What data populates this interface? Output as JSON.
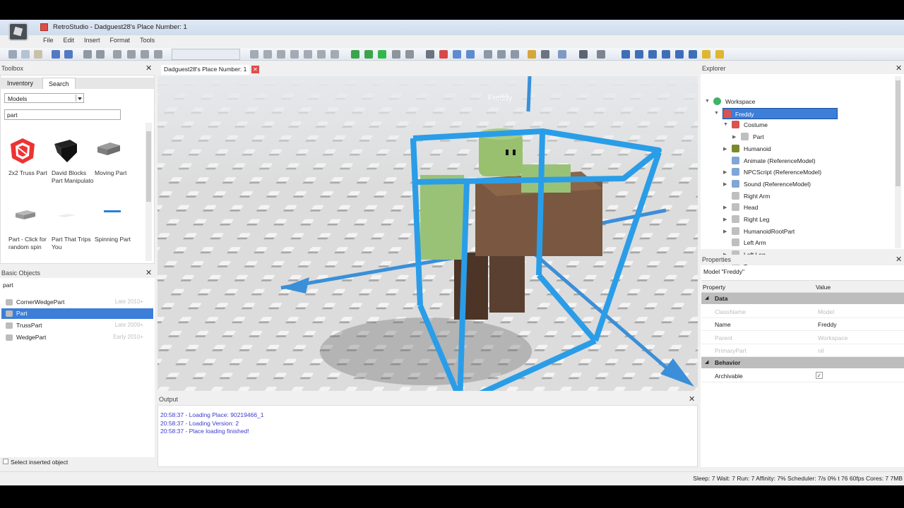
{
  "window": {
    "title": "RetroStudio - Dadguest28's Place Number: 1"
  },
  "menu": [
    "File",
    "Edit",
    "Insert",
    "Format",
    "Tools"
  ],
  "toolbox": {
    "title": "Toolbox",
    "tabs": [
      "Inventory",
      "Search"
    ],
    "category": "Models",
    "search_value": "part",
    "models": [
      {
        "label": "2x2 Truss Part",
        "icon": "truss-icon"
      },
      {
        "label": "David Blocks Part Manipulato",
        "icon": "manipulator-icon"
      },
      {
        "label": "Moving Part",
        "icon": "brick-icon"
      },
      {
        "label": "Part - Click for random spin",
        "icon": "brick-icon"
      },
      {
        "label": "Part That Trips You",
        "icon": "flat-part-icon"
      },
      {
        "label": "Spinning Part",
        "icon": "bar-icon"
      }
    ]
  },
  "basic_objects": {
    "title": "Basic Objects",
    "search_value": "part",
    "items": [
      {
        "label": "CornerWedgePart",
        "date": "Late 2010+"
      },
      {
        "label": "Part",
        "date": ""
      },
      {
        "label": "TrussPart",
        "date": "Late 2009+"
      },
      {
        "label": "WedgePart",
        "date": "Early 2010+"
      }
    ],
    "checkbox_label": "Select inserted object"
  },
  "document_tab": "Dadguest28's Place Number: 1",
  "viewport": {
    "name_tag": "Freddy"
  },
  "output": {
    "title": "Output",
    "lines": [
      "20:58:37 - Loading Place: 90219466_1",
      "20:58:37 - Loading Version: 2",
      "20:58:37 - Place loading finished!"
    ]
  },
  "explorer": {
    "title": "Explorer",
    "items": [
      {
        "label": "Workspace",
        "depth": 0,
        "icon": "globe-icon"
      },
      {
        "label": "Freddy",
        "depth": 1,
        "icon": "model-icon",
        "selected": true
      },
      {
        "label": "Costume",
        "depth": 2,
        "icon": "model-icon"
      },
      {
        "label": "Part",
        "depth": 3,
        "icon": "part-icon"
      },
      {
        "label": "Humanoid",
        "depth": 2,
        "icon": "humanoid-icon"
      },
      {
        "label": "Animate (ReferenceModel)",
        "depth": 2,
        "icon": "script-icon"
      },
      {
        "label": "NPCScript (ReferenceModel)",
        "depth": 2,
        "icon": "script-icon"
      },
      {
        "label": "Sound (ReferenceModel)",
        "depth": 2,
        "icon": "script-icon"
      },
      {
        "label": "Right Arm",
        "depth": 2,
        "icon": "part-icon"
      },
      {
        "label": "Head",
        "depth": 2,
        "icon": "part-icon"
      },
      {
        "label": "Right Leg",
        "depth": 2,
        "icon": "part-icon"
      },
      {
        "label": "HumanoidRootPart",
        "depth": 2,
        "icon": "part-icon"
      },
      {
        "label": "Left Arm",
        "depth": 2,
        "icon": "part-icon"
      },
      {
        "label": "Left Leg",
        "depth": 2,
        "icon": "part-icon"
      },
      {
        "label": "Torso",
        "depth": 2,
        "icon": "part-icon"
      }
    ]
  },
  "properties": {
    "title": "Properties",
    "subtitle": "Model \"Freddy\"",
    "col_property": "Property",
    "col_value": "Value",
    "categories": [
      {
        "name": "Data",
        "rows": [
          {
            "k": "ClassName",
            "v": "Model",
            "dim": true
          },
          {
            "k": "Name",
            "v": "Freddy",
            "dim": false
          },
          {
            "k": "Parent",
            "v": "Workspace",
            "dim": true
          },
          {
            "k": "PrimaryPart",
            "v": "nil",
            "dim": true
          }
        ]
      },
      {
        "name": "Behavior",
        "rows": [
          {
            "k": "Archivable",
            "v": "✓",
            "dim": false
          }
        ]
      }
    ]
  },
  "status": "Sleep: 7 Wait: 7 Run: 7 Affinity: 7% Scheduler: 7/s 0%   t 76   60fps   Cores: 7   7MB",
  "colors": {
    "accent": "#3c7ed8",
    "selection_box": "#2a9de8",
    "output_text": "#3a3ad0"
  }
}
